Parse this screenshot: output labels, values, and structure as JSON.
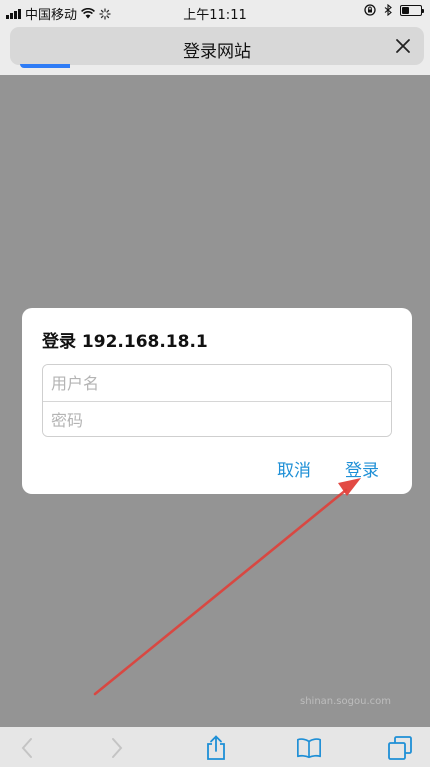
{
  "status_bar": {
    "carrier": "中国移动",
    "time": "上午11:11",
    "battery_level": 0.4
  },
  "header": {
    "title": "登录网站",
    "close_icon": "close-icon",
    "load_progress": 0.12
  },
  "dialog": {
    "title": "登录 192.168.18.1",
    "username_placeholder": "用户名",
    "password_placeholder": "密码",
    "cancel_label": "取消",
    "login_label": "登录"
  },
  "watermark": "shinan.sogou.com",
  "colors": {
    "accent": "#1e8fd6",
    "progress": "#2e7cf6",
    "arrow": "#e0403a",
    "overlay": "#949494"
  },
  "toolbar": {
    "icons": [
      "back-icon",
      "forward-icon",
      "share-icon",
      "bookmarks-icon",
      "tabs-icon"
    ]
  }
}
